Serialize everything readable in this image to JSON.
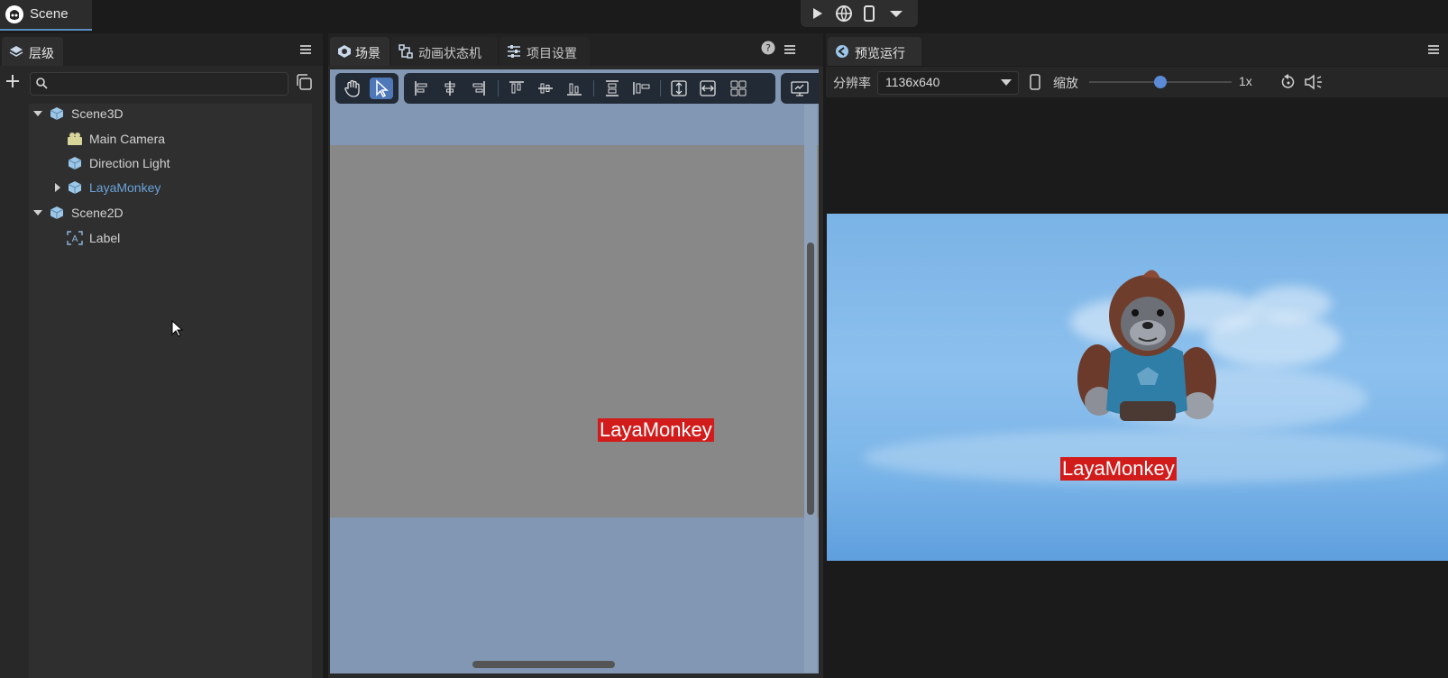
{
  "app": {
    "scene_tab": "Scene"
  },
  "hierarchy": {
    "tab": "层级",
    "search_placeholder": "",
    "items": [
      {
        "label": "Scene3D",
        "expanded": true,
        "icon": "cube-icon"
      },
      {
        "label": "Main Camera",
        "icon": "camera-icon"
      },
      {
        "label": "Direction Light",
        "icon": "cube-icon"
      },
      {
        "label": "LayaMonkey",
        "collapsed": true,
        "selected": true,
        "icon": "cube-icon"
      },
      {
        "label": "Scene2D",
        "expanded": true,
        "icon": "cube-icon"
      },
      {
        "label": "Label",
        "icon": "label-icon"
      }
    ]
  },
  "scene_panel": {
    "tabs": [
      "场景",
      "动画状态机",
      "项目设置"
    ],
    "canvas_label": "LayaMonkey"
  },
  "preview": {
    "tab": "预览运行",
    "resolution_label": "分辨率",
    "resolution_value": "1136x640",
    "zoom_label": "缩放",
    "zoom_value": "1x",
    "zoom_level": 0.5,
    "game_label": "LayaMonkey"
  },
  "colors": {
    "accent": "#4f78b8",
    "selected_text": "#6aa3d8",
    "label_bg": "#d21b1b"
  }
}
